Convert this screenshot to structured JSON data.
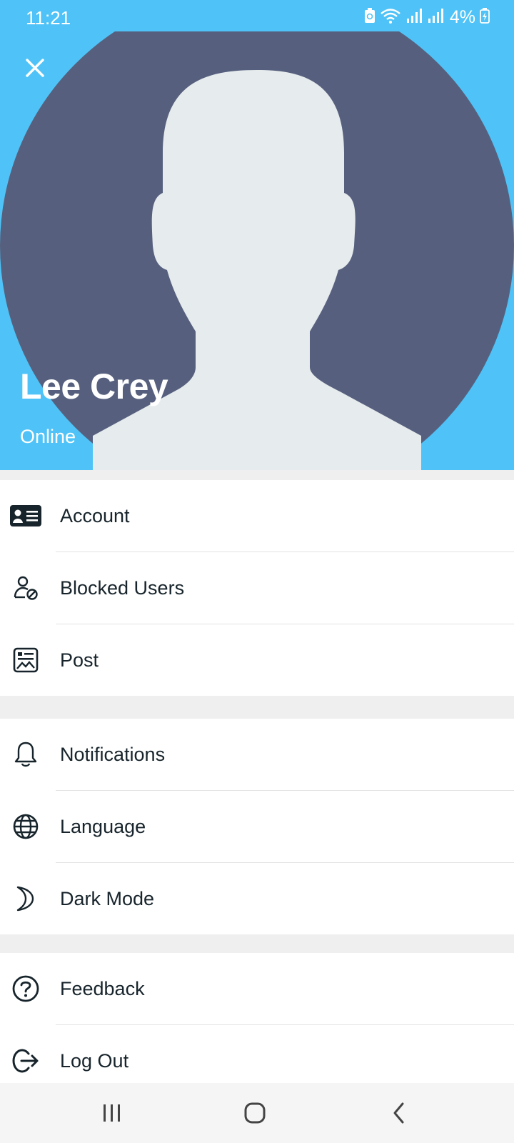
{
  "status_bar": {
    "time": "11:21",
    "battery_percent": "4%",
    "icons": [
      "battery-saver-icon",
      "wifi-icon",
      "signal-1-icon",
      "signal-2-icon",
      "battery-charging-icon"
    ]
  },
  "profile": {
    "name": "Lee Crey",
    "status": "Online",
    "header_color": "#4fc3f7",
    "avatar_bg_color": "#56607e",
    "avatar_figure_color": "#e6ebed"
  },
  "menu": {
    "group1": [
      {
        "label": "Account",
        "icon": "id-card-icon"
      },
      {
        "label": "Blocked Users",
        "icon": "blocked-user-icon"
      },
      {
        "label": "Post",
        "icon": "post-image-icon"
      }
    ],
    "group2": [
      {
        "label": "Notifications",
        "icon": "bell-icon"
      },
      {
        "label": "Language",
        "icon": "globe-icon"
      },
      {
        "label": "Dark Mode",
        "icon": "moon-icon"
      }
    ],
    "group3": [
      {
        "label": "Feedback",
        "icon": "help-circle-icon"
      },
      {
        "label": "Log Out",
        "icon": "logout-icon"
      }
    ]
  },
  "nav_bar": {
    "buttons": [
      "recent-apps-icon",
      "home-icon",
      "back-icon"
    ]
  },
  "colors": {
    "text_primary": "#17242b",
    "section_gap": "#efefef"
  }
}
